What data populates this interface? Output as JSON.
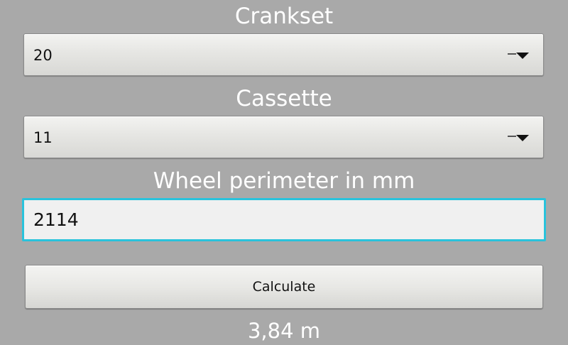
{
  "crankset": {
    "label": "Crankset",
    "selected": "20"
  },
  "cassette": {
    "label": "Cassette",
    "selected": "11"
  },
  "wheel": {
    "label": "Wheel perimeter in mm",
    "value": "2114"
  },
  "calculate_button": {
    "label": "Calculate"
  },
  "result": {
    "text": "3,84 m"
  },
  "colors": {
    "background": "#a9a9a9",
    "focus_border": "#29c3dc",
    "label_text": "#ffffff"
  },
  "icons": {
    "spinner_caret": "dropdown-caret-icon"
  }
}
